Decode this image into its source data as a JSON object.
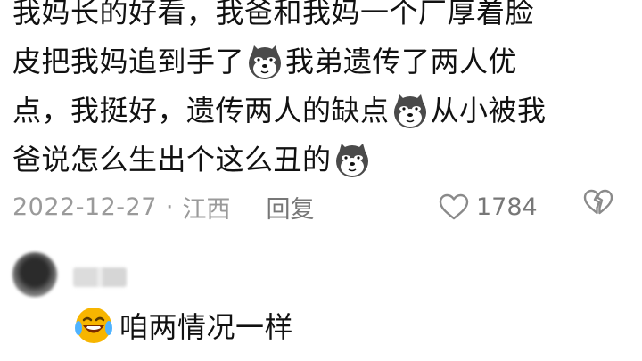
{
  "comment": {
    "lines": [
      {
        "parts": [
          "我妈长的好看，我爸和我妈一个厂厚着脸"
        ]
      },
      {
        "parts": [
          "皮把我妈追到手了",
          "我弟遗传了两人优"
        ]
      },
      {
        "parts": [
          "点，我挺好，遗传两人的缺点",
          "从小被我"
        ]
      },
      {
        "parts": [
          "爸说怎么生出个这么丑的",
          ""
        ]
      }
    ],
    "emoji_icon": "dog-face-icon"
  },
  "meta": {
    "date": "2022-12-27",
    "separator": "·",
    "location": "江西",
    "reply_label": "回复",
    "like_icon": "heart-outline-icon",
    "like_count": "1784",
    "dislike_icon": "broken-heart-icon"
  },
  "reply": {
    "text": "咱两情况一样",
    "emoji_icon": "laughing-tears-icon"
  },
  "colors": {
    "text": "#111111",
    "meta": "#9a9a9a",
    "emoji_yellow": "#f7b500"
  }
}
